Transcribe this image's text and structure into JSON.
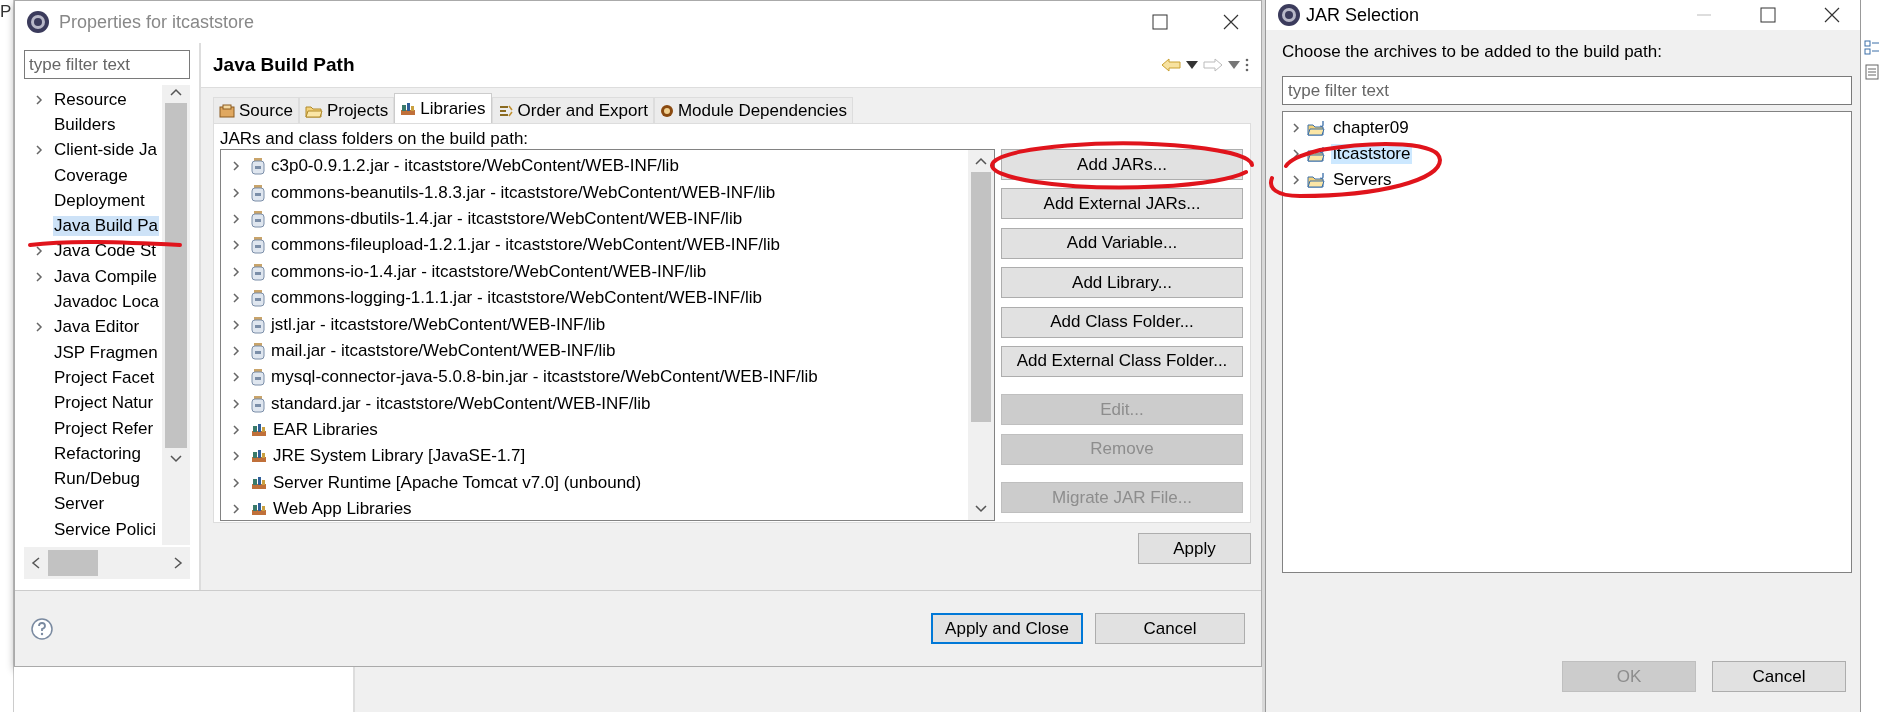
{
  "background": {
    "corner_text": "P"
  },
  "properties_dialog": {
    "title": "Properties for itcaststore",
    "filter": {
      "placeholder": "type filter text"
    },
    "categories": [
      {
        "label": "Resource",
        "expandable": true,
        "selected": false
      },
      {
        "label": "Builders",
        "expandable": false,
        "selected": false
      },
      {
        "label": "Client-side Ja",
        "expandable": true,
        "selected": false
      },
      {
        "label": "Coverage",
        "expandable": false,
        "selected": false
      },
      {
        "label": "Deployment",
        "expandable": false,
        "selected": false
      },
      {
        "label": "Java Build Pa",
        "expandable": false,
        "selected": true
      },
      {
        "label": "Java Code St",
        "expandable": true,
        "selected": false
      },
      {
        "label": "Java Compile",
        "expandable": true,
        "selected": false
      },
      {
        "label": "Javadoc Loca",
        "expandable": false,
        "selected": false
      },
      {
        "label": "Java Editor",
        "expandable": true,
        "selected": false
      },
      {
        "label": "JSP Fragmen",
        "expandable": false,
        "selected": false
      },
      {
        "label": "Project Facet",
        "expandable": false,
        "selected": false
      },
      {
        "label": "Project Natur",
        "expandable": false,
        "selected": false
      },
      {
        "label": "Project Refer",
        "expandable": false,
        "selected": false
      },
      {
        "label": "Refactoring",
        "expandable": false,
        "selected": false
      },
      {
        "label": "Run/Debug",
        "expandable": false,
        "selected": false
      },
      {
        "label": "Server",
        "expandable": false,
        "selected": false
      },
      {
        "label": "Service Polici",
        "expandable": false,
        "selected": false
      }
    ],
    "page_title": "Java Build Path",
    "tabs": [
      {
        "label": "Source",
        "selected": false
      },
      {
        "label": "Projects",
        "selected": false
      },
      {
        "label": "Libraries",
        "selected": true
      },
      {
        "label": "Order and Export",
        "selected": false
      },
      {
        "label": "Module Dependencies",
        "selected": false
      }
    ],
    "list_label": "JARs and class folders on the build path:",
    "entries": [
      {
        "label": "c3p0-0.9.1.2.jar - itcaststore/WebContent/WEB-INF/lib",
        "kind": "jar"
      },
      {
        "label": "commons-beanutils-1.8.3.jar - itcaststore/WebContent/WEB-INF/lib",
        "kind": "jar"
      },
      {
        "label": "commons-dbutils-1.4.jar - itcaststore/WebContent/WEB-INF/lib",
        "kind": "jar"
      },
      {
        "label": "commons-fileupload-1.2.1.jar - itcaststore/WebContent/WEB-INF/lib",
        "kind": "jar"
      },
      {
        "label": "commons-io-1.4.jar - itcaststore/WebContent/WEB-INF/lib",
        "kind": "jar"
      },
      {
        "label": "commons-logging-1.1.1.jar - itcaststore/WebContent/WEB-INF/lib",
        "kind": "jar"
      },
      {
        "label": "jstl.jar - itcaststore/WebContent/WEB-INF/lib",
        "kind": "jar"
      },
      {
        "label": "mail.jar - itcaststore/WebContent/WEB-INF/lib",
        "kind": "jar"
      },
      {
        "label": "mysql-connector-java-5.0.8-bin.jar - itcaststore/WebContent/WEB-INF/lib",
        "kind": "jar"
      },
      {
        "label": "standard.jar - itcaststore/WebContent/WEB-INF/lib",
        "kind": "jar"
      },
      {
        "label": "EAR Libraries",
        "kind": "library"
      },
      {
        "label": "JRE System Library [JavaSE-1.7]",
        "kind": "library"
      },
      {
        "label": "Server Runtime [Apache Tomcat v7.0] (unbound)",
        "kind": "library"
      },
      {
        "label": "Web App Libraries",
        "kind": "library"
      }
    ],
    "side_buttons": [
      {
        "label": "Add JARs...",
        "disabled": false
      },
      {
        "label": "Add External JARs...",
        "disabled": false
      },
      {
        "label": "Add Variable...",
        "disabled": false
      },
      {
        "label": "Add Library...",
        "disabled": false
      },
      {
        "label": "Add Class Folder...",
        "disabled": false
      },
      {
        "label": "Add External Class Folder...",
        "disabled": false
      },
      {
        "label": "Edit...",
        "disabled": true
      },
      {
        "label": "Remove",
        "disabled": true
      },
      {
        "label": "Migrate JAR File...",
        "disabled": true
      }
    ],
    "apply": "Apply",
    "footer_buttons": [
      {
        "label": "Apply and Close",
        "default": true
      },
      {
        "label": "Cancel",
        "default": false
      }
    ]
  },
  "jar_dialog": {
    "title": "JAR Selection",
    "prompt": "Choose the archives to be added to the build path:",
    "filter": {
      "placeholder": "type filter text"
    },
    "projects": [
      {
        "label": "chapter09",
        "selected": false
      },
      {
        "label": "itcaststore",
        "selected": true
      },
      {
        "label": "Servers",
        "selected": false
      }
    ],
    "buttons": [
      {
        "label": "OK",
        "disabled": true
      },
      {
        "label": "Cancel",
        "disabled": false
      }
    ]
  }
}
